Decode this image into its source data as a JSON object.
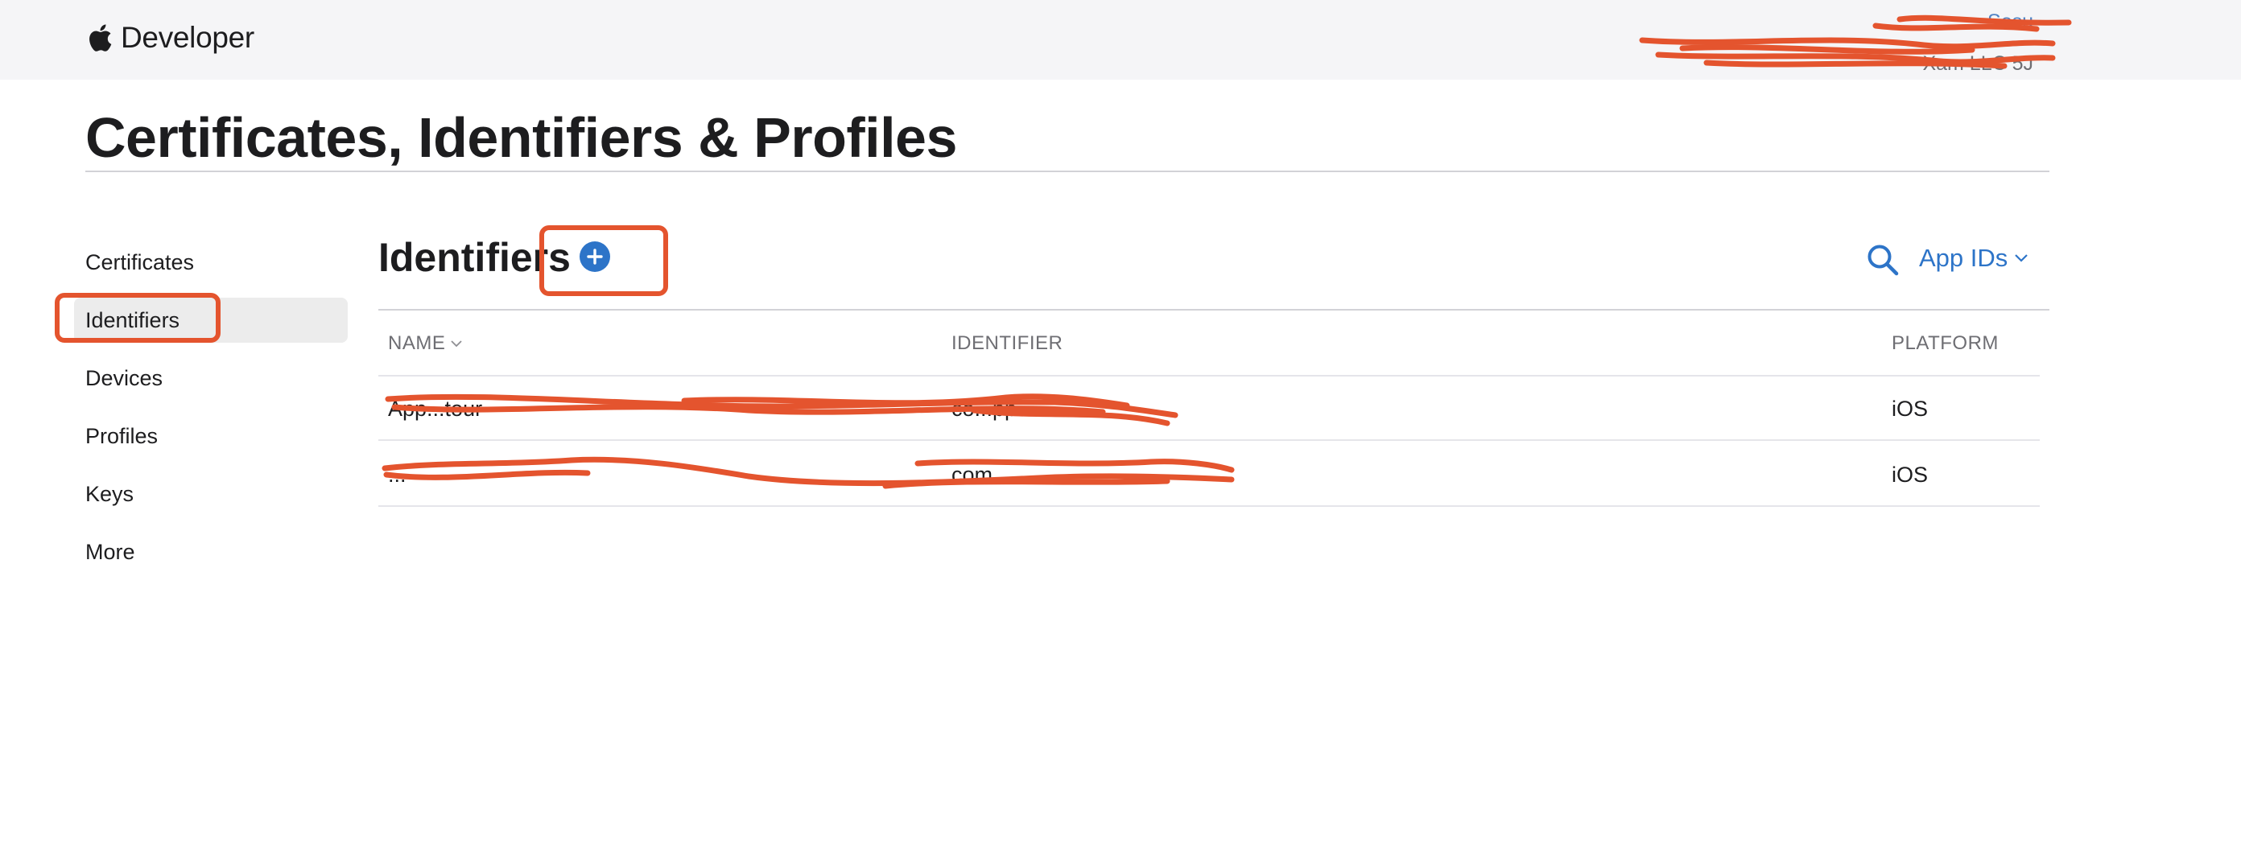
{
  "header": {
    "brand": "Developer",
    "account_name": "Sosu",
    "account_team": "Xam LLC 5J"
  },
  "page": {
    "title": "Certificates, Identifiers & Profiles"
  },
  "sidebar": {
    "items": [
      {
        "label": "Certificates"
      },
      {
        "label": "Identifiers"
      },
      {
        "label": "Devices"
      },
      {
        "label": "Profiles"
      },
      {
        "label": "Keys"
      },
      {
        "label": "More"
      }
    ]
  },
  "main": {
    "section_title": "Identifiers",
    "filter_label": "App IDs",
    "columns": {
      "name": "NAME",
      "identifier": "IDENTIFIER",
      "platform": "PLATFORM"
    },
    "rows": [
      {
        "name": "App...tour",
        "identifier": "co...pp",
        "platform": "iOS"
      },
      {
        "name": "...",
        "identifier": "com...",
        "platform": "iOS"
      }
    ]
  },
  "colors": {
    "accent": "#2d74c8",
    "annotation": "#e4542e",
    "topbar_bg": "#f5f5f7"
  }
}
